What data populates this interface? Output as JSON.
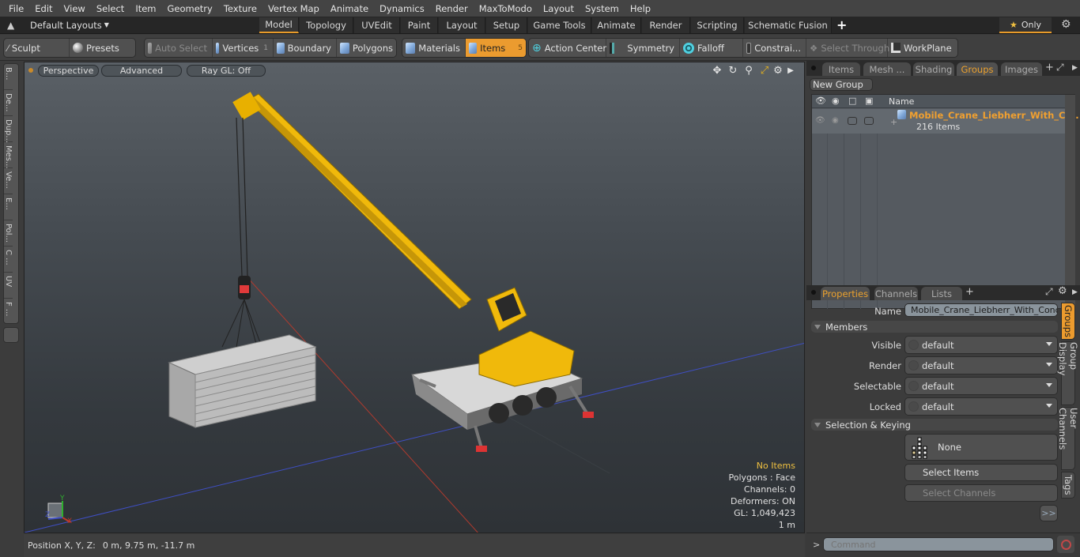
{
  "menu": [
    "File",
    "Edit",
    "View",
    "Select",
    "Item",
    "Geometry",
    "Texture",
    "Vertex Map",
    "Animate",
    "Dynamics",
    "Render",
    "MaxToModo",
    "Layout",
    "System",
    "Help"
  ],
  "layoutbar": {
    "layouts_label": "Default Layouts",
    "tabs": [
      "Model",
      "Topology",
      "UVEdit",
      "Paint",
      "Layout",
      "Setup",
      "Game Tools",
      "Animate",
      "Render",
      "Scripting",
      "Schematic Fusion"
    ],
    "active_tab": "Model",
    "add_tab": "+",
    "only_label": "Only"
  },
  "toolbar": {
    "sculpt": "Sculpt",
    "presets": "Presets",
    "auto_select": "Auto Select",
    "vertices": "Vertices",
    "vertices_count": "1",
    "boundary": "Boundary",
    "polygons": "Polygons",
    "materials": "Materials",
    "items": "Items",
    "items_count": "5",
    "action_center": "Action Center",
    "symmetry": "Symmetry",
    "falloff": "Falloff",
    "constraints": "Constrai...",
    "select_through": "Select Through",
    "workplane": "WorkPlane"
  },
  "left_strip": [
    "B...",
    "De...",
    "Dup...",
    "Mes...",
    "Ve...",
    "E...",
    "Pol...",
    "C ...",
    "UV",
    "F ..."
  ],
  "viewport": {
    "view_mode": "Perspective",
    "shading": "Advanced",
    "ray_gl": "Ray GL: Off",
    "info": {
      "selection": "No Items",
      "polygons": "Polygons : Face",
      "channels": "Channels: 0",
      "deformers": "Deformers: ON",
      "gl": "GL: 1,049,423",
      "scale": "1 m"
    },
    "axis": {
      "x": "X",
      "y": "Y",
      "z": "Z"
    },
    "colors": {
      "x_axis": "#c0392b",
      "z_axis": "#3f4fc4",
      "crane_yellow": "#f0b90b",
      "selection_info": "#f0c040"
    }
  },
  "status": {
    "position_label": "Position X, Y, Z:",
    "position_value": "0 m, 9.75 m, -11.7 m"
  },
  "groups_panel": {
    "tabs": [
      "Items",
      "Mesh ...",
      "Shading",
      "Groups",
      "Images"
    ],
    "active_tab": "Groups",
    "new_group": "New Group",
    "column_name": "Name",
    "rows": [
      {
        "name": "Mobile_Crane_Liebherr_With_C ...",
        "count": "216 Items"
      }
    ]
  },
  "properties_panel": {
    "tabs": [
      "Properties",
      "Channels",
      "Lists"
    ],
    "active_tab": "Properties",
    "name_label": "Name",
    "name_value": "Mobile_Crane_Liebherr_With_Concret",
    "members_section": "Members",
    "fields": [
      {
        "label": "Visible",
        "value": "default"
      },
      {
        "label": "Render",
        "value": "default"
      },
      {
        "label": "Selectable",
        "value": "default"
      },
      {
        "label": "Locked",
        "value": "default"
      }
    ],
    "selection_section": "Selection & Keying",
    "none_label": "None",
    "select_items": "Select Items",
    "select_channels": "Select Channels",
    "more": ">>",
    "side_tabs": [
      "Groups",
      "Group Display",
      "User Channels",
      "Tags"
    ],
    "active_side_tab": "Groups"
  },
  "command": {
    "prompt": ">",
    "placeholder": "Command"
  }
}
